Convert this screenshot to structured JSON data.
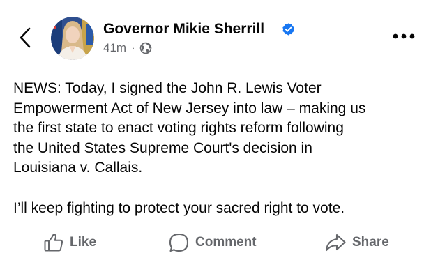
{
  "colors": {
    "text_primary": "#050505",
    "text_secondary": "#65676b",
    "verified_blue": "#1877f2",
    "background": "#ffffff"
  },
  "header": {
    "back_icon": "chevron-left-icon",
    "author_name": "Governor Mikie Sherrill",
    "verified": true,
    "timestamp": "41m",
    "separator": "·",
    "audience_icon": "globe-icon",
    "more_icon": "more-horizontal-icon"
  },
  "post": {
    "text": "NEWS: Today, I signed the John R. Lewis Voter\nEmpowerment Act of New Jersey into law – making us\nthe first state to enact voting rights reform following\nthe United States Supreme Court's decision in\nLouisiana v. Callais.\n\nI’ll keep fighting to protect your sacred right to vote."
  },
  "actions": {
    "like_label": "Like",
    "comment_label": "Comment",
    "share_label": "Share"
  }
}
